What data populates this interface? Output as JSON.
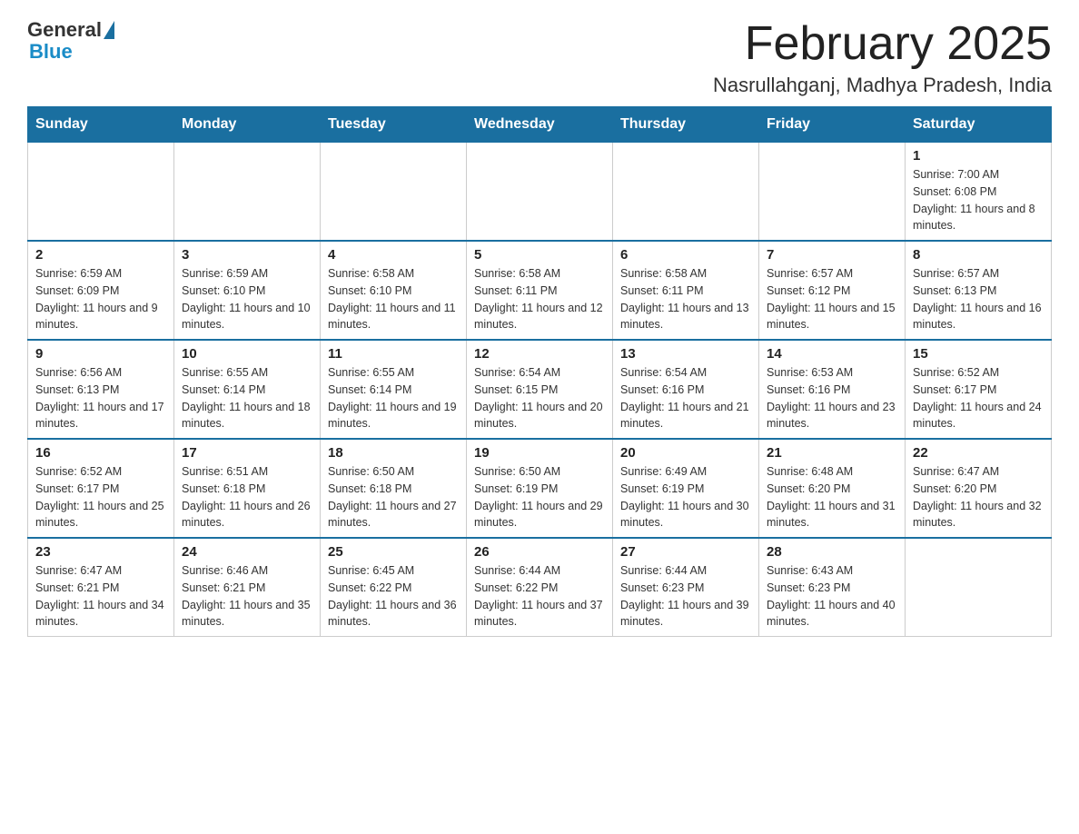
{
  "header": {
    "logo_general": "General",
    "logo_blue": "Blue",
    "month_title": "February 2025",
    "location": "Nasrullahganj, Madhya Pradesh, India"
  },
  "days_of_week": [
    "Sunday",
    "Monday",
    "Tuesday",
    "Wednesday",
    "Thursday",
    "Friday",
    "Saturday"
  ],
  "weeks": [
    [
      {
        "day": "",
        "info": ""
      },
      {
        "day": "",
        "info": ""
      },
      {
        "day": "",
        "info": ""
      },
      {
        "day": "",
        "info": ""
      },
      {
        "day": "",
        "info": ""
      },
      {
        "day": "",
        "info": ""
      },
      {
        "day": "1",
        "info": "Sunrise: 7:00 AM\nSunset: 6:08 PM\nDaylight: 11 hours and 8 minutes."
      }
    ],
    [
      {
        "day": "2",
        "info": "Sunrise: 6:59 AM\nSunset: 6:09 PM\nDaylight: 11 hours and 9 minutes."
      },
      {
        "day": "3",
        "info": "Sunrise: 6:59 AM\nSunset: 6:10 PM\nDaylight: 11 hours and 10 minutes."
      },
      {
        "day": "4",
        "info": "Sunrise: 6:58 AM\nSunset: 6:10 PM\nDaylight: 11 hours and 11 minutes."
      },
      {
        "day": "5",
        "info": "Sunrise: 6:58 AM\nSunset: 6:11 PM\nDaylight: 11 hours and 12 minutes."
      },
      {
        "day": "6",
        "info": "Sunrise: 6:58 AM\nSunset: 6:11 PM\nDaylight: 11 hours and 13 minutes."
      },
      {
        "day": "7",
        "info": "Sunrise: 6:57 AM\nSunset: 6:12 PM\nDaylight: 11 hours and 15 minutes."
      },
      {
        "day": "8",
        "info": "Sunrise: 6:57 AM\nSunset: 6:13 PM\nDaylight: 11 hours and 16 minutes."
      }
    ],
    [
      {
        "day": "9",
        "info": "Sunrise: 6:56 AM\nSunset: 6:13 PM\nDaylight: 11 hours and 17 minutes."
      },
      {
        "day": "10",
        "info": "Sunrise: 6:55 AM\nSunset: 6:14 PM\nDaylight: 11 hours and 18 minutes."
      },
      {
        "day": "11",
        "info": "Sunrise: 6:55 AM\nSunset: 6:14 PM\nDaylight: 11 hours and 19 minutes."
      },
      {
        "day": "12",
        "info": "Sunrise: 6:54 AM\nSunset: 6:15 PM\nDaylight: 11 hours and 20 minutes."
      },
      {
        "day": "13",
        "info": "Sunrise: 6:54 AM\nSunset: 6:16 PM\nDaylight: 11 hours and 21 minutes."
      },
      {
        "day": "14",
        "info": "Sunrise: 6:53 AM\nSunset: 6:16 PM\nDaylight: 11 hours and 23 minutes."
      },
      {
        "day": "15",
        "info": "Sunrise: 6:52 AM\nSunset: 6:17 PM\nDaylight: 11 hours and 24 minutes."
      }
    ],
    [
      {
        "day": "16",
        "info": "Sunrise: 6:52 AM\nSunset: 6:17 PM\nDaylight: 11 hours and 25 minutes."
      },
      {
        "day": "17",
        "info": "Sunrise: 6:51 AM\nSunset: 6:18 PM\nDaylight: 11 hours and 26 minutes."
      },
      {
        "day": "18",
        "info": "Sunrise: 6:50 AM\nSunset: 6:18 PM\nDaylight: 11 hours and 27 minutes."
      },
      {
        "day": "19",
        "info": "Sunrise: 6:50 AM\nSunset: 6:19 PM\nDaylight: 11 hours and 29 minutes."
      },
      {
        "day": "20",
        "info": "Sunrise: 6:49 AM\nSunset: 6:19 PM\nDaylight: 11 hours and 30 minutes."
      },
      {
        "day": "21",
        "info": "Sunrise: 6:48 AM\nSunset: 6:20 PM\nDaylight: 11 hours and 31 minutes."
      },
      {
        "day": "22",
        "info": "Sunrise: 6:47 AM\nSunset: 6:20 PM\nDaylight: 11 hours and 32 minutes."
      }
    ],
    [
      {
        "day": "23",
        "info": "Sunrise: 6:47 AM\nSunset: 6:21 PM\nDaylight: 11 hours and 34 minutes."
      },
      {
        "day": "24",
        "info": "Sunrise: 6:46 AM\nSunset: 6:21 PM\nDaylight: 11 hours and 35 minutes."
      },
      {
        "day": "25",
        "info": "Sunrise: 6:45 AM\nSunset: 6:22 PM\nDaylight: 11 hours and 36 minutes."
      },
      {
        "day": "26",
        "info": "Sunrise: 6:44 AM\nSunset: 6:22 PM\nDaylight: 11 hours and 37 minutes."
      },
      {
        "day": "27",
        "info": "Sunrise: 6:44 AM\nSunset: 6:23 PM\nDaylight: 11 hours and 39 minutes."
      },
      {
        "day": "28",
        "info": "Sunrise: 6:43 AM\nSunset: 6:23 PM\nDaylight: 11 hours and 40 minutes."
      },
      {
        "day": "",
        "info": ""
      }
    ]
  ]
}
